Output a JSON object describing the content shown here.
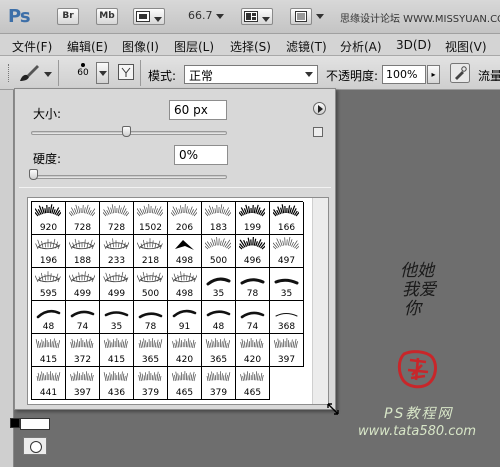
{
  "app": {
    "logo": "Ps",
    "bridge_btn": "Br",
    "minibridge_btn": "Mb",
    "zoom_level": "66.7",
    "watermark_top": "思缘设计论坛 WWW.MISSYUAN.COM"
  },
  "menu": [
    "文件(F)",
    "编辑(E)",
    "图像(I)",
    "图层(L)",
    "选择(S)",
    "滤镜(T)",
    "分析(A)",
    "3D(D)",
    "视图(V)"
  ],
  "options": {
    "brush_size_sample": "60",
    "mode_label": "模式:",
    "mode_value": "正常",
    "opacity_label": "不透明度:",
    "opacity_value": "100%",
    "flow_label": "流量"
  },
  "brush_picker": {
    "size_label": "大小:",
    "size_value": "60 px",
    "size_fraction": 0.22,
    "hardness_label": "硬度:",
    "hardness_value": "0%",
    "hardness_fraction": 0.0,
    "brushes": [
      "920",
      "728",
      "728",
      "1502",
      "206",
      "183",
      "199",
      "166",
      "196",
      "188",
      "233",
      "218",
      "498",
      "500",
      "496",
      "497",
      "595",
      "499",
      "499",
      "500",
      "498",
      "35",
      "78",
      "35",
      "48",
      "74",
      "35",
      "78",
      "91",
      "48",
      "74",
      "368",
      "415",
      "372",
      "415",
      "365",
      "420",
      "365",
      "420",
      "397",
      "441",
      "397",
      "436",
      "379",
      "465",
      "379",
      "465"
    ]
  },
  "watermark": {
    "vertical_text": "他她\n我爱\n你",
    "ps_text": "PS教程网",
    "url": "www.tata580.com"
  },
  "colors": {
    "canvas_bg": "#6e6e6e",
    "panel_bg": "#d8d8d8",
    "seal_red": "#c8262a"
  }
}
